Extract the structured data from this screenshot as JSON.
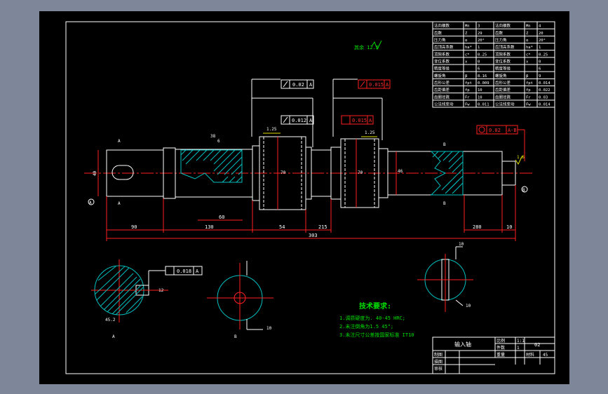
{
  "params_table": [
    [
      "法向模数",
      "Mn",
      "3",
      "法向模数",
      "Mn",
      "4"
    ],
    [
      "齿数",
      "Z",
      "29",
      "齿数",
      "Z",
      "20"
    ],
    [
      "压力角",
      "α",
      "20°",
      "压力角",
      "α",
      "20°"
    ],
    [
      "齿顶高系数",
      "ha*",
      "1",
      "齿顶高系数",
      "ha*",
      "1"
    ],
    [
      "顶隙系数",
      "c*",
      "0.25",
      "顶隙系数",
      "c*",
      "0.25"
    ],
    [
      "变位系数",
      "x",
      "0",
      "变位系数",
      "x",
      "0"
    ],
    [
      "精度等级",
      "",
      "6",
      "精度等级",
      "",
      "6"
    ],
    [
      "螺旋角",
      "β",
      "8.16",
      "螺旋角",
      "β",
      "9"
    ],
    [
      "齿形公差",
      "fpt",
      "0.009",
      "齿形公差",
      "fpt",
      "0.014"
    ],
    [
      "齿距偏差",
      "fp",
      "10",
      "齿距偏差",
      "fp",
      "0.022"
    ],
    [
      "齿圈径跳",
      "Fr",
      "10",
      "齿圈径跳",
      "Fr",
      "0.03"
    ],
    [
      "公法线变动",
      "Fw",
      "0.011",
      "公法线变动",
      "Fw",
      "0.014"
    ]
  ],
  "roughness_top": "其余 12.5",
  "tolerances": {
    "runout_1": "0.02",
    "runout_1_ref": "A",
    "runout_2": "0.012",
    "runout_2_ref": "A",
    "runout_3": "0.015",
    "runout_3_ref": "A",
    "runout_4": "0.02",
    "runout_4_ref": "A-B",
    "symmetry": "0.018",
    "symmetry_ref": "A",
    "roughness_gear1": "1.25",
    "roughness_gear2": "1.25",
    "roughness_right": "1.6"
  },
  "dims": {
    "d1": "90",
    "d2": "130",
    "d3": "60",
    "d4": "54",
    "d5": "215",
    "d6": "280",
    "d7": "10",
    "total": "303",
    "key_w": "38",
    "key_d": "6",
    "dia_left": "40",
    "dia_mid": "70",
    "dia_r": "46",
    "sec1_dia": "45.2",
    "sec1_w": "12",
    "sec3_w": "10",
    "sec2_r": "10",
    "depth": "10"
  },
  "labels": {
    "datum_a": "A",
    "datum_b": "B",
    "sec_a": "A",
    "sec_b": "B",
    "sec_c": "C"
  },
  "tech_req": {
    "title": "技术要求:",
    "lines": [
      "1.调质硬度为. 40-45  HRC;",
      "2.未注倒角为1.5  45°;",
      "3.未注尺寸公差按国家标准  IT10"
    ]
  },
  "title_block": {
    "part_name": "输入轴",
    "scale_label": "比例",
    "scale": "1:1",
    "qty_label": "件数",
    "qty": "1",
    "weight_label": "重量",
    "material_label": "材料",
    "material": "45",
    "drawing_no": "02",
    "designer_label": "制图",
    "check_label": "描图",
    "audit_label": "审核"
  }
}
